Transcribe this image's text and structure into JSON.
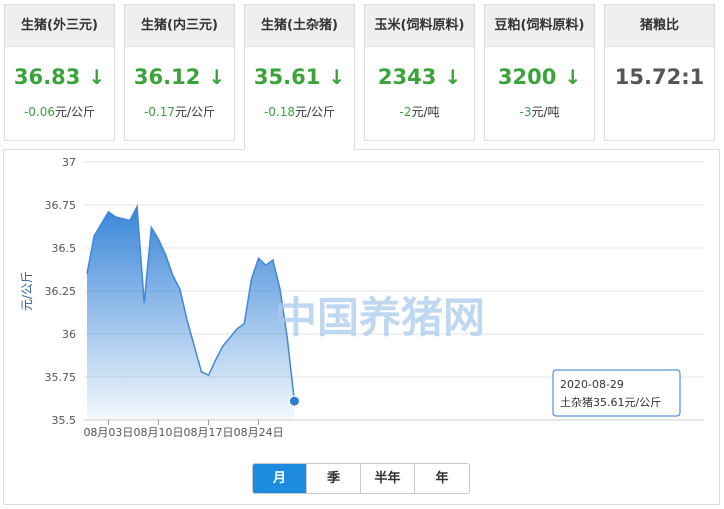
{
  "cards": [
    {
      "title": "生猪(外三元)",
      "value": "36.83",
      "change": "-0.06",
      "unit": "元/公斤",
      "trend": "down"
    },
    {
      "title": "生猪(内三元)",
      "value": "36.12",
      "change": "-0.17",
      "unit": "元/公斤",
      "trend": "down"
    },
    {
      "title": "生猪(土杂猪)",
      "value": "35.61",
      "change": "-0.18",
      "unit": "元/公斤",
      "trend": "down",
      "active": true
    },
    {
      "title": "玉米(饲料原料)",
      "value": "2343",
      "change": "-2",
      "unit": "元/吨",
      "trend": "down"
    },
    {
      "title": "豆粕(饲料原料)",
      "value": "3200",
      "change": "-3",
      "unit": "元/吨",
      "trend": "down"
    },
    {
      "title": "猪粮比",
      "value": "15.72:1",
      "change": "",
      "unit": "",
      "trend": "none"
    }
  ],
  "icons": {
    "down": "arrow-down-icon"
  },
  "colors": {
    "accent": "#1d8ce0",
    "down": "#3aa33a",
    "line": "#3f88d8"
  },
  "watermark": "中国养猪网",
  "tooltip": {
    "date": "2020-08-29",
    "text": "土杂猪35.61元/公斤"
  },
  "tabs": [
    {
      "label": "月",
      "active": true
    },
    {
      "label": "季",
      "active": false
    },
    {
      "label": "半年",
      "active": false
    },
    {
      "label": "年",
      "active": false
    }
  ],
  "chart_data": {
    "type": "area",
    "ylabel": "元/公斤",
    "ylim": [
      35.5,
      37
    ],
    "yticks": [
      35.5,
      35.75,
      36,
      36.25,
      36.5,
      36.75,
      37
    ],
    "ytick_labels": [
      "35.5",
      "35.75",
      "36",
      "36.25",
      "36.5",
      "36.75",
      "37"
    ],
    "xtick_labels": [
      "08月03日",
      "08月10日",
      "08月17日",
      "08月24日"
    ],
    "grid": true,
    "series": [
      {
        "x": [
          "2020-07-31",
          "2020-08-01",
          "2020-08-02",
          "2020-08-03",
          "2020-08-04",
          "2020-08-05",
          "2020-08-06",
          "2020-08-07",
          "2020-08-08",
          "2020-08-09",
          "2020-08-10",
          "2020-08-11",
          "2020-08-12",
          "2020-08-13",
          "2020-08-14",
          "2020-08-15",
          "2020-08-16",
          "2020-08-17",
          "2020-08-18",
          "2020-08-19",
          "2020-08-20",
          "2020-08-21",
          "2020-08-22",
          "2020-08-23",
          "2020-08-24",
          "2020-08-25",
          "2020-08-26",
          "2020-08-27",
          "2020-08-28",
          "2020-08-29"
        ],
        "values": [
          36.35,
          36.57,
          36.64,
          36.71,
          36.68,
          36.67,
          36.66,
          36.74,
          36.18,
          36.62,
          36.55,
          36.46,
          36.34,
          36.26,
          36.08,
          35.93,
          35.78,
          35.76,
          35.85,
          35.93,
          35.98,
          36.03,
          36.06,
          36.32,
          36.44,
          36.4,
          36.43,
          36.26,
          35.98,
          35.61
        ]
      }
    ]
  }
}
